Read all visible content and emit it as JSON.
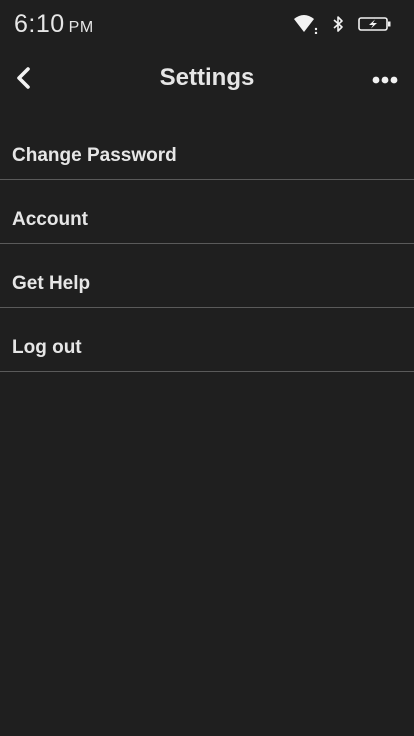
{
  "status_bar": {
    "time": "6:10",
    "ampm": "PM",
    "icons": [
      "wifi-icon",
      "bluetooth-icon",
      "battery-charging-icon"
    ]
  },
  "nav": {
    "title": "Settings",
    "back_icon": "chevron-left-icon",
    "more_icon": "more-dots-icon"
  },
  "settings": {
    "items": [
      {
        "label": "Change Password"
      },
      {
        "label": "Account"
      },
      {
        "label": "Get Help"
      },
      {
        "label": "Log out"
      }
    ]
  },
  "colors": {
    "background": "#1f1f1f",
    "text": "#e6e6e6",
    "divider": "#5a5a5a"
  }
}
